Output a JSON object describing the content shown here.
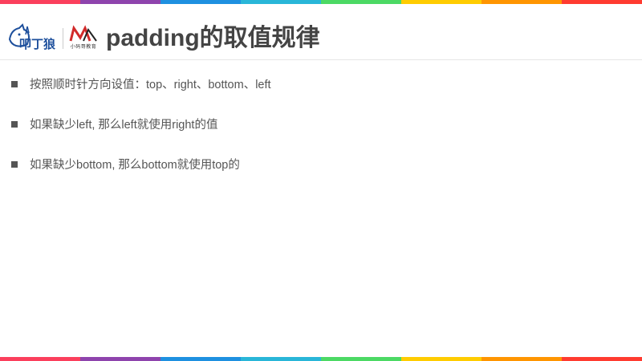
{
  "colors": {
    "rainbow": [
      "#fb3f5c",
      "#8e44ad",
      "#1e90e0",
      "#29b6d8",
      "#4cd964",
      "#ffcc00",
      "#ff9500",
      "#ff3b30"
    ],
    "title": "#444444",
    "text": "#555555"
  },
  "header": {
    "logo_primary_text": "叩丁狼",
    "logo_secondary_text": "小码哥教育",
    "title": "padding的取值规律"
  },
  "bullets": [
    {
      "text": "按照顺时针方向设值：top、right、bottom、left"
    },
    {
      "text": "如果缺少left, 那么left就使用right的值"
    },
    {
      "text": "如果缺少bottom, 那么bottom就使用top的"
    }
  ]
}
